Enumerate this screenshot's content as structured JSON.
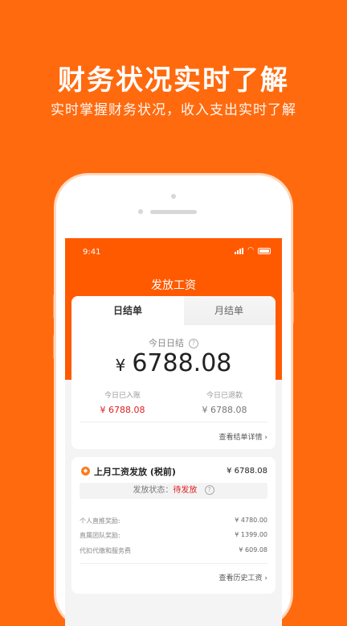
{
  "promo": {
    "title": "财务状况实时了解",
    "subtitle": "实时掌握财务状况，收入支出实时了解"
  },
  "status_bar": {
    "time": "9:41"
  },
  "nav": {
    "title": "发放工资"
  },
  "tabs": {
    "day": "日结单",
    "month": "月结单"
  },
  "today": {
    "label": "今日日结",
    "currency": "¥",
    "amount": "6788.08",
    "received_label": "今日已入账",
    "received_value": "¥ 6788.08",
    "refunded_label": "今日已退款",
    "refunded_value": "¥ 6788.08",
    "detail_link": "查看结单详情 ›"
  },
  "salary": {
    "title": "上月工资发放 (税前)",
    "amount": "¥ 6788.08",
    "status_label": "发放状态：",
    "status_value": "待发放",
    "items": [
      {
        "label": "个人直推奖励:",
        "value": "¥ 4780.00"
      },
      {
        "label": "直属团队奖励:",
        "value": "¥ 1399.00"
      },
      {
        "label": "代扣代缴和服务费",
        "value": "¥ 609.08"
      }
    ],
    "history_link": "查看历史工资 ›"
  },
  "colors": {
    "brand": "#ff6a0e",
    "nav": "#ff5a00",
    "accent_red": "#e02020"
  }
}
